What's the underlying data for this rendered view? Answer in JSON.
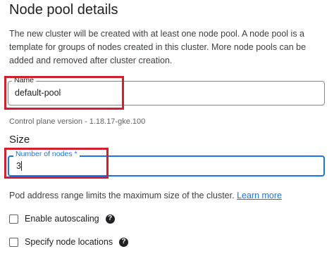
{
  "page": {
    "title": "Node pool details",
    "description": "The new cluster will be created with at least one node pool. A node pool is a template for groups of nodes created in this cluster. More node pools can be added and removed after cluster creation."
  },
  "name_field": {
    "label": "Name",
    "value": "default-pool"
  },
  "control_plane_hint": "Control plane version - 1.18.17-gke.100",
  "size_section": {
    "title": "Size",
    "nodes_field": {
      "label": "Number of nodes *",
      "value": "3"
    },
    "pod_range_text": "Pod address range limits the maximum size of the cluster.",
    "learn_more": "Learn more"
  },
  "options": {
    "autoscaling": {
      "label": "Enable autoscaling",
      "checked": false
    },
    "node_locations": {
      "label": "Specify node locations",
      "checked": false
    }
  },
  "icons": {
    "help": "help-circle-icon"
  },
  "colors": {
    "accent": "#1a73e8",
    "highlight": "#d0202e"
  }
}
